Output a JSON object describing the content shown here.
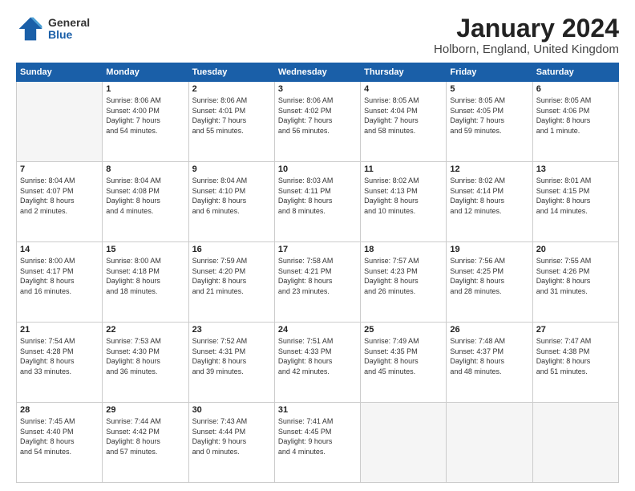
{
  "header": {
    "logo_general": "General",
    "logo_blue": "Blue",
    "month_title": "January 2024",
    "location": "Holborn, England, United Kingdom"
  },
  "weekdays": [
    "Sunday",
    "Monday",
    "Tuesday",
    "Wednesday",
    "Thursday",
    "Friday",
    "Saturday"
  ],
  "weeks": [
    [
      {
        "day": "",
        "info": ""
      },
      {
        "day": "1",
        "info": "Sunrise: 8:06 AM\nSunset: 4:00 PM\nDaylight: 7 hours\nand 54 minutes."
      },
      {
        "day": "2",
        "info": "Sunrise: 8:06 AM\nSunset: 4:01 PM\nDaylight: 7 hours\nand 55 minutes."
      },
      {
        "day": "3",
        "info": "Sunrise: 8:06 AM\nSunset: 4:02 PM\nDaylight: 7 hours\nand 56 minutes."
      },
      {
        "day": "4",
        "info": "Sunrise: 8:05 AM\nSunset: 4:04 PM\nDaylight: 7 hours\nand 58 minutes."
      },
      {
        "day": "5",
        "info": "Sunrise: 8:05 AM\nSunset: 4:05 PM\nDaylight: 7 hours\nand 59 minutes."
      },
      {
        "day": "6",
        "info": "Sunrise: 8:05 AM\nSunset: 4:06 PM\nDaylight: 8 hours\nand 1 minute."
      }
    ],
    [
      {
        "day": "7",
        "info": "Sunrise: 8:04 AM\nSunset: 4:07 PM\nDaylight: 8 hours\nand 2 minutes."
      },
      {
        "day": "8",
        "info": "Sunrise: 8:04 AM\nSunset: 4:08 PM\nDaylight: 8 hours\nand 4 minutes."
      },
      {
        "day": "9",
        "info": "Sunrise: 8:04 AM\nSunset: 4:10 PM\nDaylight: 8 hours\nand 6 minutes."
      },
      {
        "day": "10",
        "info": "Sunrise: 8:03 AM\nSunset: 4:11 PM\nDaylight: 8 hours\nand 8 minutes."
      },
      {
        "day": "11",
        "info": "Sunrise: 8:02 AM\nSunset: 4:13 PM\nDaylight: 8 hours\nand 10 minutes."
      },
      {
        "day": "12",
        "info": "Sunrise: 8:02 AM\nSunset: 4:14 PM\nDaylight: 8 hours\nand 12 minutes."
      },
      {
        "day": "13",
        "info": "Sunrise: 8:01 AM\nSunset: 4:15 PM\nDaylight: 8 hours\nand 14 minutes."
      }
    ],
    [
      {
        "day": "14",
        "info": "Sunrise: 8:00 AM\nSunset: 4:17 PM\nDaylight: 8 hours\nand 16 minutes."
      },
      {
        "day": "15",
        "info": "Sunrise: 8:00 AM\nSunset: 4:18 PM\nDaylight: 8 hours\nand 18 minutes."
      },
      {
        "day": "16",
        "info": "Sunrise: 7:59 AM\nSunset: 4:20 PM\nDaylight: 8 hours\nand 21 minutes."
      },
      {
        "day": "17",
        "info": "Sunrise: 7:58 AM\nSunset: 4:21 PM\nDaylight: 8 hours\nand 23 minutes."
      },
      {
        "day": "18",
        "info": "Sunrise: 7:57 AM\nSunset: 4:23 PM\nDaylight: 8 hours\nand 26 minutes."
      },
      {
        "day": "19",
        "info": "Sunrise: 7:56 AM\nSunset: 4:25 PM\nDaylight: 8 hours\nand 28 minutes."
      },
      {
        "day": "20",
        "info": "Sunrise: 7:55 AM\nSunset: 4:26 PM\nDaylight: 8 hours\nand 31 minutes."
      }
    ],
    [
      {
        "day": "21",
        "info": "Sunrise: 7:54 AM\nSunset: 4:28 PM\nDaylight: 8 hours\nand 33 minutes."
      },
      {
        "day": "22",
        "info": "Sunrise: 7:53 AM\nSunset: 4:30 PM\nDaylight: 8 hours\nand 36 minutes."
      },
      {
        "day": "23",
        "info": "Sunrise: 7:52 AM\nSunset: 4:31 PM\nDaylight: 8 hours\nand 39 minutes."
      },
      {
        "day": "24",
        "info": "Sunrise: 7:51 AM\nSunset: 4:33 PM\nDaylight: 8 hours\nand 42 minutes."
      },
      {
        "day": "25",
        "info": "Sunrise: 7:49 AM\nSunset: 4:35 PM\nDaylight: 8 hours\nand 45 minutes."
      },
      {
        "day": "26",
        "info": "Sunrise: 7:48 AM\nSunset: 4:37 PM\nDaylight: 8 hours\nand 48 minutes."
      },
      {
        "day": "27",
        "info": "Sunrise: 7:47 AM\nSunset: 4:38 PM\nDaylight: 8 hours\nand 51 minutes."
      }
    ],
    [
      {
        "day": "28",
        "info": "Sunrise: 7:45 AM\nSunset: 4:40 PM\nDaylight: 8 hours\nand 54 minutes."
      },
      {
        "day": "29",
        "info": "Sunrise: 7:44 AM\nSunset: 4:42 PM\nDaylight: 8 hours\nand 57 minutes."
      },
      {
        "day": "30",
        "info": "Sunrise: 7:43 AM\nSunset: 4:44 PM\nDaylight: 9 hours\nand 0 minutes."
      },
      {
        "day": "31",
        "info": "Sunrise: 7:41 AM\nSunset: 4:45 PM\nDaylight: 9 hours\nand 4 minutes."
      },
      {
        "day": "",
        "info": ""
      },
      {
        "day": "",
        "info": ""
      },
      {
        "day": "",
        "info": ""
      }
    ]
  ]
}
